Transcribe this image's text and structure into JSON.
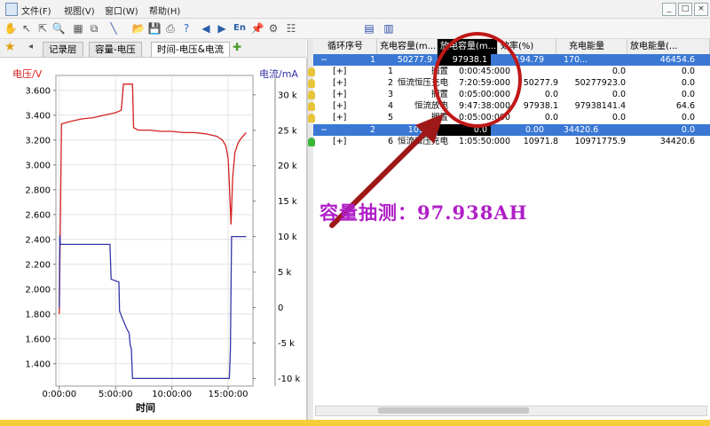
{
  "menu": {
    "file": "文件(F)",
    "view": "视图(V)",
    "window": "窗口(W)",
    "help": "帮助(H)"
  },
  "window_controls": {
    "minimize": "_",
    "restore": "□",
    "close": "×"
  },
  "tabs": [
    "记录层",
    "容量-电压",
    "时间-电压&电流"
  ],
  "chart_data": {
    "type": "line",
    "ylabel_left": "电压/V",
    "ylabel_right": "电流/mA",
    "xlabel": "时间",
    "x_ticks": [
      "0:00:00",
      "5:00:00",
      "10:00:00",
      "15:00:00"
    ],
    "x_tick_values": [
      0,
      5,
      10,
      15
    ],
    "xlim": [
      -0.3,
      17.2
    ],
    "y_left_ticks": [
      "1.400",
      "1.600",
      "1.800",
      "2.000",
      "2.200",
      "2.400",
      "2.600",
      "2.800",
      "3.000",
      "3.200",
      "3.400",
      "3.600"
    ],
    "y_left_tick_values": [
      1.4,
      1.6,
      1.8,
      2.0,
      2.2,
      2.4,
      2.6,
      2.8,
      3.0,
      3.2,
      3.4,
      3.6
    ],
    "ylim_left": [
      1.22,
      3.72
    ],
    "y_right_ticks": [
      "-10 k",
      "-5 k",
      "0",
      "5 k",
      "10 k",
      "15 k",
      "20 k",
      "25 k",
      "30 k"
    ],
    "y_right_tick_values": [
      -10000,
      -5000,
      0,
      5000,
      10000,
      15000,
      20000,
      25000,
      30000
    ],
    "ylim_right": [
      -11070,
      32730
    ],
    "grid": true,
    "series": [
      {
        "color": "#d42020",
        "axis": "left",
        "x": [
          0,
          0.2,
          1,
          2,
          3,
          4,
          5,
          5.5,
          5.7,
          5.8,
          6.5,
          6.6,
          6.8,
          7,
          8,
          9,
          10,
          11,
          12,
          13,
          14,
          14.5,
          14.8,
          15,
          15.1,
          15.25,
          15.4,
          15.6,
          15.9,
          16.2,
          16.6
        ],
        "y": [
          1.8,
          3.33,
          3.35,
          3.37,
          3.38,
          3.4,
          3.42,
          3.44,
          3.65,
          3.65,
          3.65,
          3.3,
          3.29,
          3.28,
          3.28,
          3.27,
          3.27,
          3.26,
          3.26,
          3.25,
          3.23,
          3.2,
          3.15,
          3.05,
          2.85,
          2.52,
          2.9,
          3.1,
          3.18,
          3.22,
          3.26
        ]
      },
      {
        "color": "#3535a8",
        "axis": "right",
        "x": [
          0,
          0.05,
          0.1,
          4.5,
          4.6,
          5.3,
          5.35,
          5.6,
          6,
          6.2,
          6.3,
          6.4,
          6.45,
          6.5,
          15.1,
          15.2,
          15.3,
          16.6
        ],
        "y": [
          0,
          10200,
          8900,
          8900,
          4000,
          3600,
          -500,
          -1500,
          -3000,
          -3600,
          -5300,
          -5800,
          -7700,
          -10000,
          -10000,
          -6000,
          10000,
          10000
        ]
      }
    ]
  },
  "grid": {
    "columns": [
      "循环序号",
      "充电容量(m...",
      "放电容量(m...",
      "效率(%)",
      "充电能量",
      "放电能量(..."
    ],
    "rows": [
      {
        "type": "group",
        "toggle": "−",
        "cycle": "1",
        "charge_cap": "50277.9",
        "discharge_cap": "97938.1",
        "efficiency": "194.79",
        "charge_energy": "170...",
        "discharge_energy": "46454.6"
      },
      {
        "type": "step",
        "toggle": "[+]",
        "index": "1",
        "name": "搁置",
        "duration": "0:00:45:000",
        "charge_cap": "",
        "charge_energy": "0.0",
        "discharge_energy": "0.0"
      },
      {
        "type": "step",
        "toggle": "[+]",
        "index": "2",
        "name": "恒流恒压充电",
        "duration": "7:20:59:000",
        "charge_cap": "50277.9",
        "charge_energy": "50277923.0",
        "discharge_energy": "0.0"
      },
      {
        "type": "step",
        "toggle": "[+]",
        "index": "3",
        "name": "搁置",
        "duration": "0:05:00:000",
        "charge_cap": "0.0",
        "charge_energy": "0.0",
        "discharge_energy": "0.0"
      },
      {
        "type": "step",
        "toggle": "[+]",
        "index": "4",
        "name": "恒流放电",
        "duration": "9:47:38:000",
        "charge_cap": "97938.1",
        "charge_energy": "97938141.4",
        "discharge_energy": "64.6"
      },
      {
        "type": "step",
        "toggle": "[+]",
        "index": "5",
        "name": "搁置",
        "duration": "0:05:00:000",
        "charge_cap": "0.0",
        "charge_energy": "0.0",
        "discharge_energy": "0.0"
      },
      {
        "type": "group",
        "toggle": "−",
        "cycle": "2",
        "charge_cap": "109...",
        "discharge_cap": "0.0",
        "efficiency": "0.00",
        "charge_energy": "34420.6",
        "discharge_energy": "0.0"
      },
      {
        "type": "step",
        "toggle": "[+]",
        "index": "6",
        "name": "恒流恒压充电",
        "duration": "1:05:50:000",
        "charge_cap": "10971.8",
        "charge_energy": "10971775.9",
        "discharge_energy": "34420.6"
      }
    ]
  },
  "annotation": {
    "text": "容量抽测：97.938AH",
    "color": "#b01ec8",
    "circle_color": "#c01818",
    "arrow_color": "#9e1818"
  }
}
